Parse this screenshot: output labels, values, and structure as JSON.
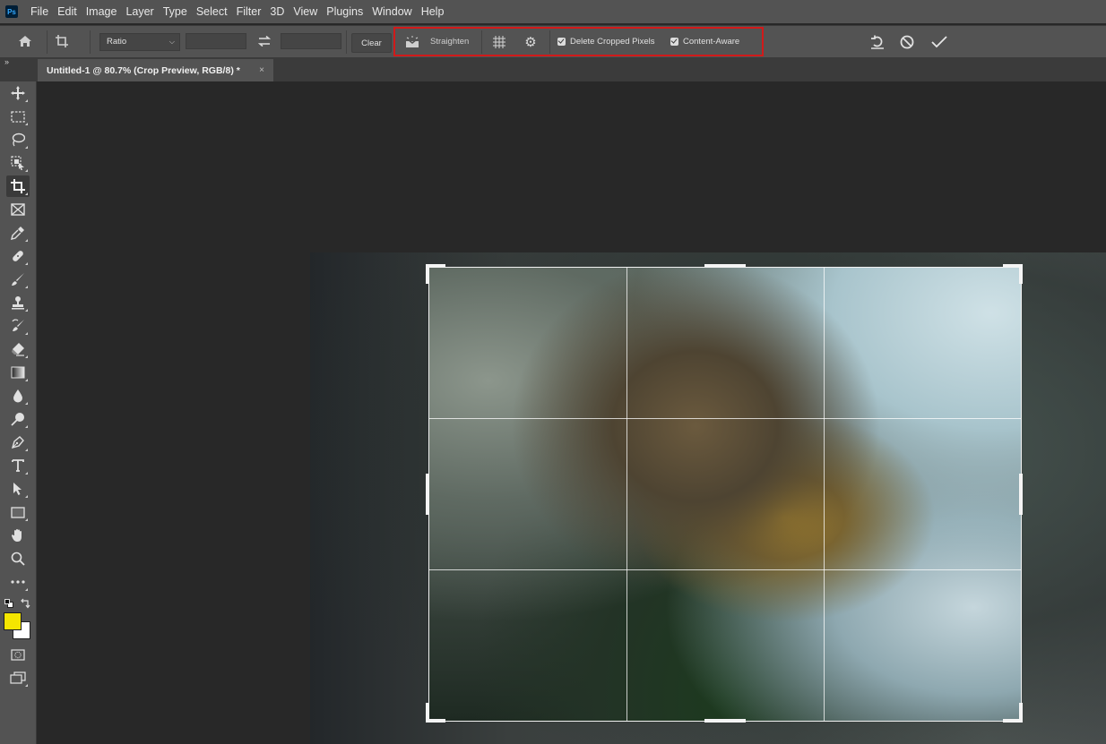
{
  "app": {
    "logo_text": "Ps",
    "menu": [
      "File",
      "Edit",
      "Image",
      "Layer",
      "Type",
      "Select",
      "Filter",
      "3D",
      "View",
      "Plugins",
      "Window",
      "Help"
    ]
  },
  "options_bar": {
    "home_icon": "home-icon",
    "tool_icon": "crop-tool-icon",
    "ratio_select": {
      "value": "Ratio"
    },
    "width_field": {
      "value": ""
    },
    "swap_icon": "swap-arrows-icon",
    "height_field": {
      "value": ""
    },
    "clear_label": "Clear",
    "straighten_label": "Straighten",
    "overlay_icon": "grid-overlay-icon",
    "settings_icon": "gear-icon",
    "delete_cropped_pixels": {
      "label": "Delete Cropped Pixels",
      "checked": true
    },
    "content_aware": {
      "label": "Content-Aware",
      "checked": true
    },
    "reset_icon": "reset-icon",
    "cancel_icon": "cancel-icon",
    "commit_icon": "checkmark-icon",
    "highlight_color": "#d11a1a"
  },
  "document": {
    "tab_title": "Untitled-1 @ 80.7% (Crop Preview, RGB/8) *",
    "close_symbol": "×",
    "collapse_symbol": "»"
  },
  "toolbar": {
    "tools": [
      {
        "name": "move-tool",
        "glyph": "✥"
      },
      {
        "name": "marquee-tool",
        "glyph": "⬚"
      },
      {
        "name": "lasso-tool",
        "glyph": "ↄ"
      },
      {
        "name": "object-selection-tool",
        "glyph": "◪"
      },
      {
        "name": "crop-tool",
        "glyph": "⌗",
        "active": true
      },
      {
        "name": "frame-tool",
        "glyph": "⊠"
      },
      {
        "name": "eyedropper-tool",
        "glyph": "✎"
      },
      {
        "name": "healing-brush-tool",
        "glyph": "✚"
      },
      {
        "name": "brush-tool",
        "glyph": "🖌"
      },
      {
        "name": "clone-stamp-tool",
        "glyph": "⊥"
      },
      {
        "name": "history-brush-tool",
        "glyph": "↯"
      },
      {
        "name": "eraser-tool",
        "glyph": "⌫"
      },
      {
        "name": "gradient-tool",
        "glyph": "▦"
      },
      {
        "name": "blur-tool",
        "glyph": "💧"
      },
      {
        "name": "dodge-tool",
        "glyph": "⚲"
      },
      {
        "name": "pen-tool",
        "glyph": "✒"
      },
      {
        "name": "type-tool",
        "glyph": "T"
      },
      {
        "name": "path-selection-tool",
        "glyph": "➤"
      },
      {
        "name": "rectangle-tool",
        "glyph": "▭"
      },
      {
        "name": "hand-tool",
        "glyph": "✋"
      },
      {
        "name": "zoom-tool",
        "glyph": "⚲"
      },
      {
        "name": "more-tools",
        "glyph": "•••"
      }
    ],
    "foreground_color": "#f5e600",
    "background_color": "#ffffff",
    "quick_mask_icon": "quick-mask-icon",
    "screen_mode_icon": "screen-mode-icon"
  }
}
